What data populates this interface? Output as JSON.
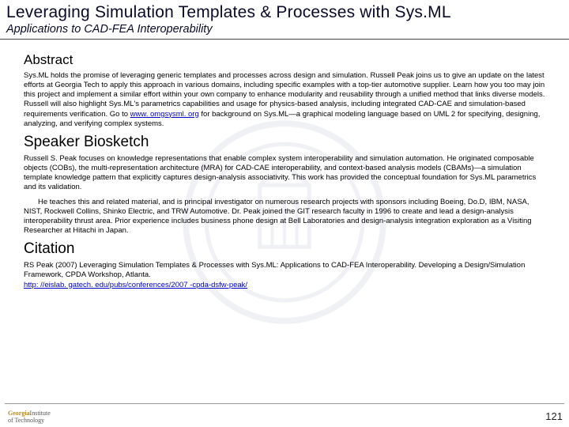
{
  "header": {
    "title": "Leveraging Simulation Templates & Processes with Sys.ML",
    "subtitle": "Applications to CAD-FEA Interoperability"
  },
  "sections": {
    "abstract": {
      "heading": "Abstract",
      "text_pre": "Sys.ML holds the promise of leveraging generic templates and processes across design and simulation. Russell Peak joins us to give an update on the latest efforts at Georgia Tech to apply this approach in various domains, including specific examples with a top-tier automotive supplier. Learn how you too may join this project and implement a similar effort within your own company to enhance modularity and reusability through a unified method that links diverse models. Russell will also highlight Sys.ML's parametrics capabilities and usage for physics-based analysis, including integrated CAD-CAE and simulation-based requirements verification. Go to ",
      "link_text": "www. omgsysml. org",
      "link_href": "http://www.omgsysml.org",
      "text_post": " for background on Sys.ML—a graphical modeling language based on UML 2 for specifying, designing, analyzing, and verifying complex systems."
    },
    "bio": {
      "heading": "Speaker Biosketch",
      "para1": "Russell S. Peak focuses on knowledge representations that enable complex system interoperability and simulation automation. He originated composable objects (COBs), the multi-representation architecture (MRA) for CAD-CAE interoperability, and context-based analysis models (CBAMs)—a simulation template knowledge pattern that explicitly captures design-analysis associativity. This work has provided the conceptual foundation for Sys.ML parametrics and its validation.",
      "para2": "He teaches this and related material, and is principal investigator on numerous research projects with sponsors including Boeing, Do.D, IBM, NASA, NIST, Rockwell Collins, Shinko Electric, and TRW Automotive. Dr. Peak joined the GIT research faculty in 1996 to create and lead a design-analysis interoperability thrust area. Prior experience includes business phone design at Bell Laboratories and design-analysis integration exploration as a Visiting Researcher at Hitachi in Japan."
    },
    "citation": {
      "heading": "Citation",
      "text": "RS Peak (2007) Leveraging Simulation Templates & Processes with Sys.ML: Applications to CAD-FEA Interoperability. Developing a Design/Simulation Framework, CPDA Workshop, Atlanta.",
      "link_text": "http: //eislab. gatech. edu/pubs/conferences/2007 -cpda-dsfw-peak/",
      "link_href": "http://eislab.gatech.edu/pubs/conferences/2007-cpda-dsfw-peak/"
    }
  },
  "footer": {
    "logo_line1": "Georgia",
    "logo_line2": "Institute",
    "logo_line3": "of Technology",
    "page": "121"
  }
}
